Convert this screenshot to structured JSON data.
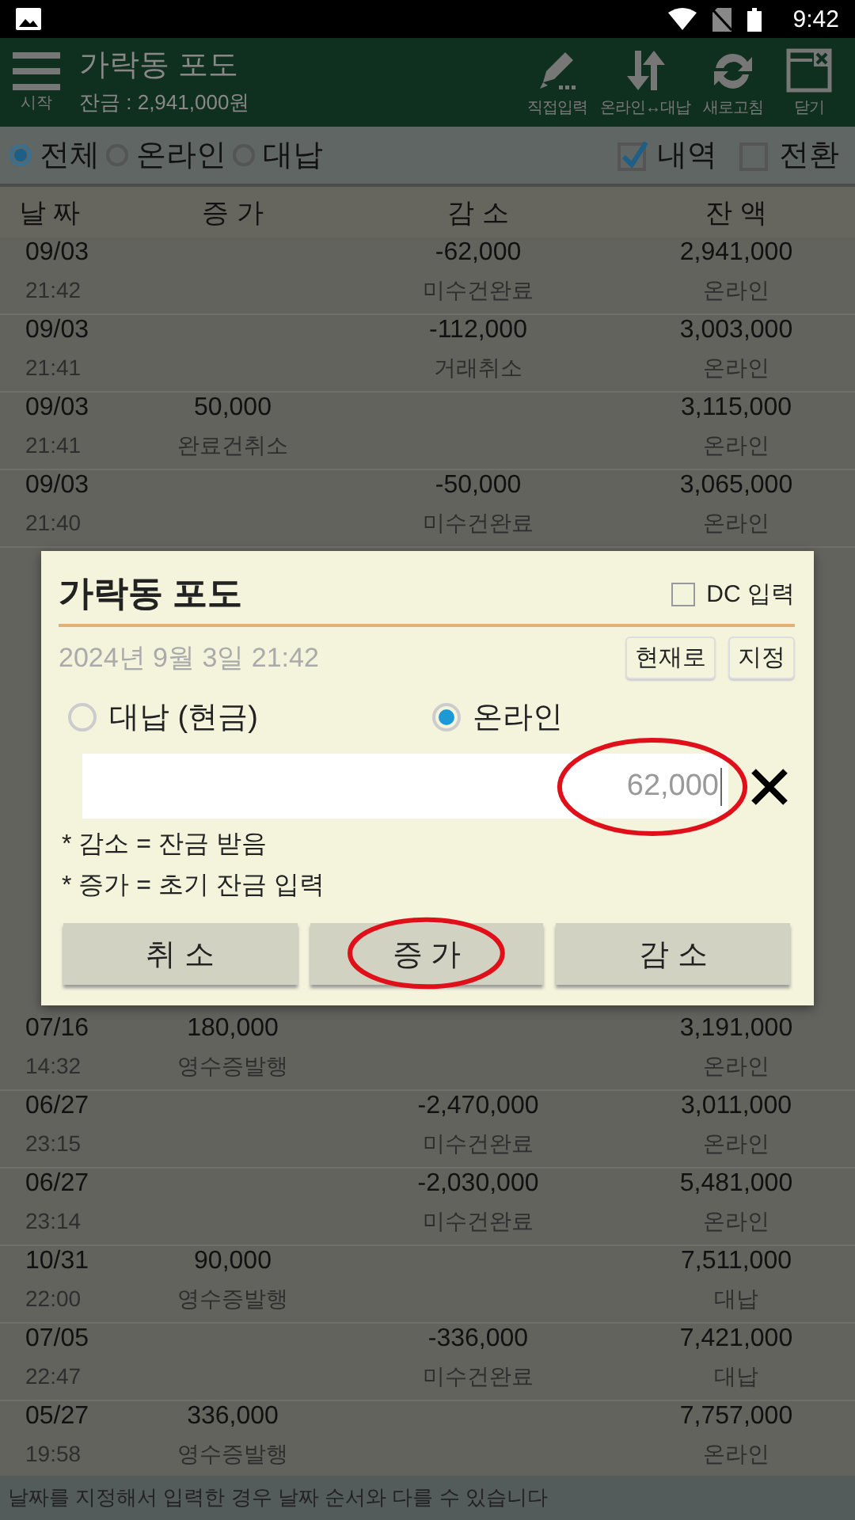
{
  "status_bar": {
    "time": "9:42"
  },
  "app_bar": {
    "menu_label": "시작",
    "title": "가락동 포도",
    "balance": "잔금 : 2,941,000원",
    "actions": [
      {
        "label": "직접입력"
      },
      {
        "label": "온라인↔대납"
      },
      {
        "label": "새로고침"
      },
      {
        "label": "닫기"
      }
    ]
  },
  "filters": {
    "radios": [
      {
        "label": "전체",
        "selected": true
      },
      {
        "label": "온라인",
        "selected": false
      },
      {
        "label": "대납",
        "selected": false
      }
    ],
    "checkboxes": [
      {
        "label": "내역",
        "checked": true
      },
      {
        "label": "전환",
        "checked": false
      }
    ]
  },
  "table": {
    "columns": [
      "날 짜",
      "증 가",
      "감 소",
      "잔 액"
    ],
    "rows": [
      {
        "date": "09/03",
        "time": "21:42",
        "decrease": "-62,000",
        "decrease_note": "미수건완료",
        "balance": "2,941,000",
        "channel": "온라인"
      },
      {
        "date": "09/03",
        "time": "21:41",
        "decrease": "-112,000",
        "decrease_note": "거래취소",
        "balance": "3,003,000",
        "channel": "온라인"
      },
      {
        "date": "09/03",
        "time": "21:41",
        "increase": "50,000",
        "increase_note": "완료건취소",
        "balance": "3,115,000",
        "channel": "온라인"
      },
      {
        "date": "09/03",
        "time": "21:40",
        "decrease": "-50,000",
        "decrease_note": "미수건완료",
        "balance": "3,065,000",
        "channel": "온라인"
      },
      {
        "date": "07/16",
        "time": "14:32",
        "increase": "180,000",
        "increase_note": "영수증발행",
        "balance": "3,191,000",
        "channel": "온라인"
      },
      {
        "date": "06/27",
        "time": "23:15",
        "decrease": "-2,470,000",
        "decrease_note": "미수건완료",
        "balance": "3,011,000",
        "channel": "온라인"
      },
      {
        "date": "06/27",
        "time": "23:14",
        "decrease": "-2,030,000",
        "decrease_note": "미수건완료",
        "balance": "5,481,000",
        "channel": "온라인"
      },
      {
        "date": "10/31",
        "time": "22:00",
        "increase": "90,000",
        "increase_note": "영수증발행",
        "balance": "7,511,000",
        "channel": "대납"
      },
      {
        "date": "07/05",
        "time": "22:47",
        "decrease": "-336,000",
        "decrease_note": "미수건완료",
        "balance": "7,421,000",
        "channel": "대납"
      },
      {
        "date": "05/27",
        "time": "19:58",
        "increase": "336,000",
        "increase_note": "영수증발행",
        "balance": "7,757,000",
        "channel": "온라인"
      }
    ]
  },
  "dialog": {
    "title": "가락동 포도",
    "dc_checkbox": {
      "label": "DC 입력",
      "checked": false
    },
    "datetime": "2024년 9월 3일 21:42",
    "date_buttons": [
      "현재로",
      "지정"
    ],
    "payment_options": [
      {
        "label": "대납 (현금)",
        "selected": false
      },
      {
        "label": "온라인",
        "selected": true
      }
    ],
    "amount": {
      "value": "62,000",
      "highlighted": true
    },
    "notes": [
      "* 감소 = 잔금 받음",
      "* 증가 = 초기 잔금 입력"
    ],
    "buttons": [
      {
        "label": "취 소",
        "highlighted": false
      },
      {
        "label": "증 가",
        "highlighted": true
      },
      {
        "label": "감 소",
        "highlighted": false
      }
    ]
  },
  "footer_note": "날짜를 지정해서 입력한 경우 날짜 순서와 다를 수 있습니다"
}
